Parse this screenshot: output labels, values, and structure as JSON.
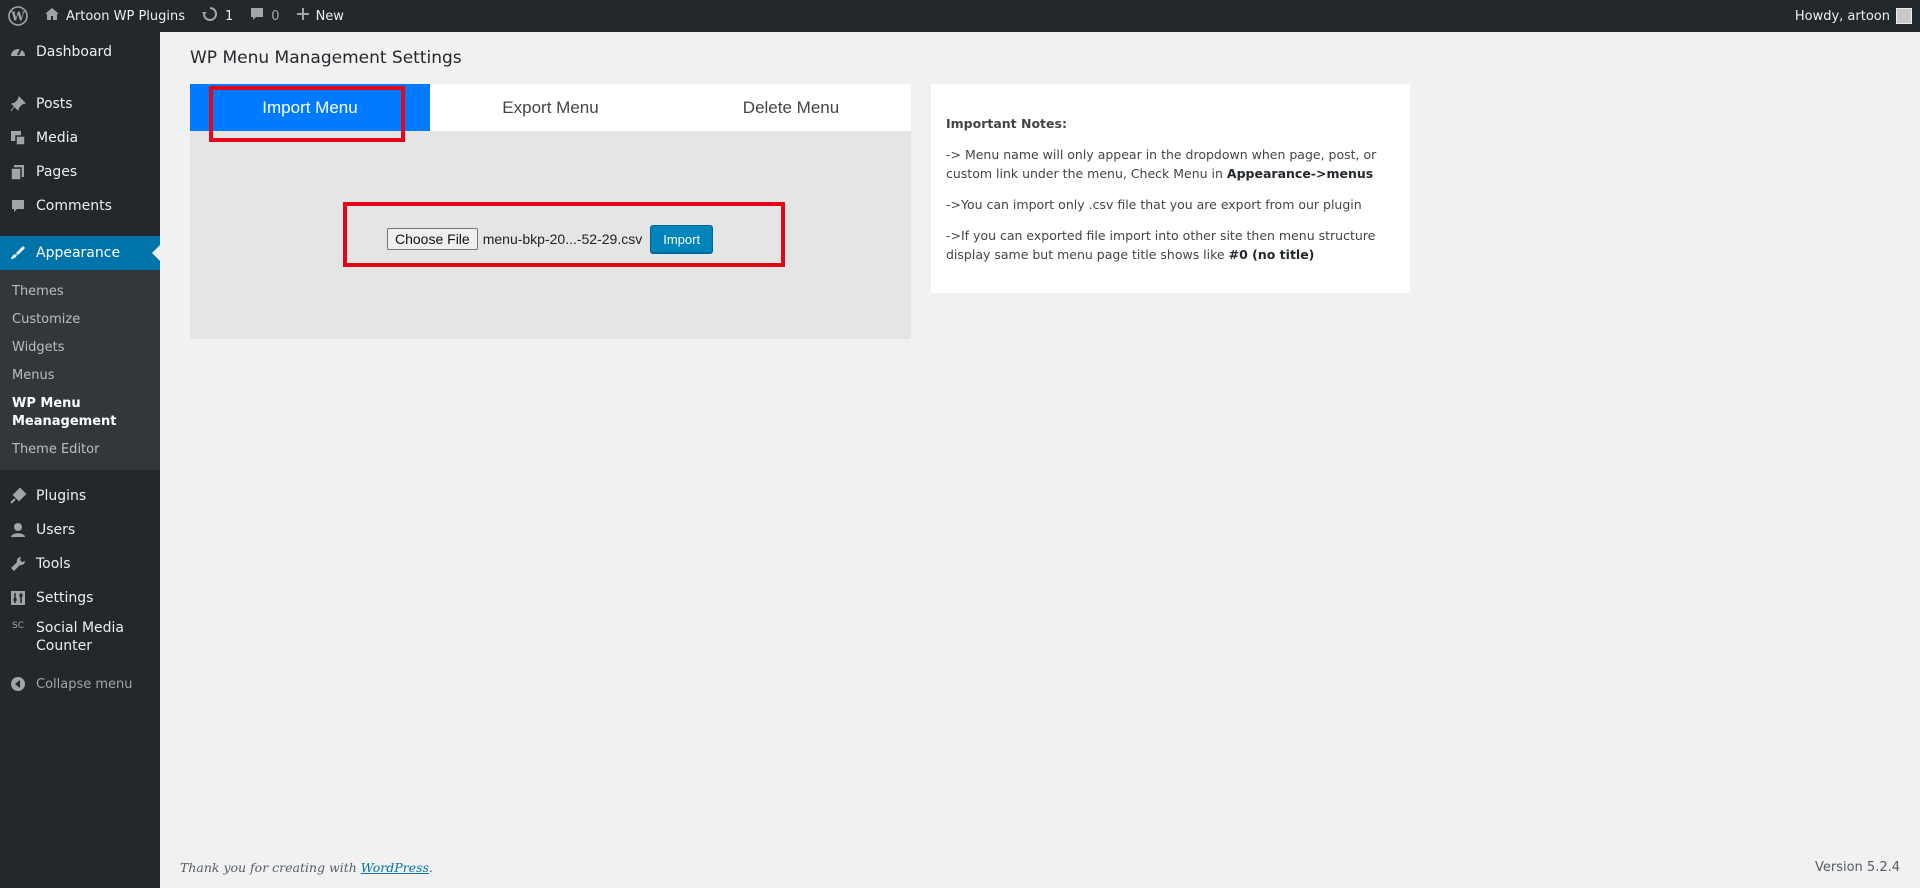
{
  "adminbar": {
    "site_name": "Artoon WP Plugins",
    "updates_count": "1",
    "comments_count": "0",
    "new_label": "New",
    "greeting": "Howdy, artoon"
  },
  "sidebar": {
    "dashboard": "Dashboard",
    "posts": "Posts",
    "media": "Media",
    "pages": "Pages",
    "comments": "Comments",
    "appearance": "Appearance",
    "submenu": [
      "Themes",
      "Customize",
      "Widgets",
      "Menus",
      "WP Menu Meanagement",
      "Theme Editor"
    ],
    "plugins": "Plugins",
    "users": "Users",
    "tools": "Tools",
    "settings": "Settings",
    "social_icon": "SC",
    "social": "Social Media Counter",
    "collapse": "Collapse menu"
  },
  "page": {
    "title": "WP Menu Management Settings",
    "tabs": [
      "Import Menu",
      "Export Menu",
      "Delete Menu"
    ],
    "choose_file": "Choose File",
    "file_name": "menu-bkp-20...-52-29.csv",
    "import_button": "Import"
  },
  "notes": {
    "heading": "Important Notes:",
    "note1_text": "-> Menu name will only appear in the dropdown when page, post, or custom link under the menu, Check Menu in",
    "note1_bold": "Appearance->menus",
    "note2": "->You can import only .csv file that you are export from our plugin",
    "note3_text": "->If you can exported file import into other site then menu structure display same but menu page title shows like",
    "note3_bold": "#0 (no title)"
  },
  "footer": {
    "thanks_prefix": "Thank you for creating with",
    "wordpress_link": "WordPress",
    "thanks_suffix": ".",
    "version": "Version 5.2.4"
  },
  "colors": {
    "adminbar_bg": "#23282d",
    "active_menu": "#0073aa",
    "active_tab": "#007bff",
    "annotation": "#e3061a",
    "import_button": "#0085ba"
  }
}
